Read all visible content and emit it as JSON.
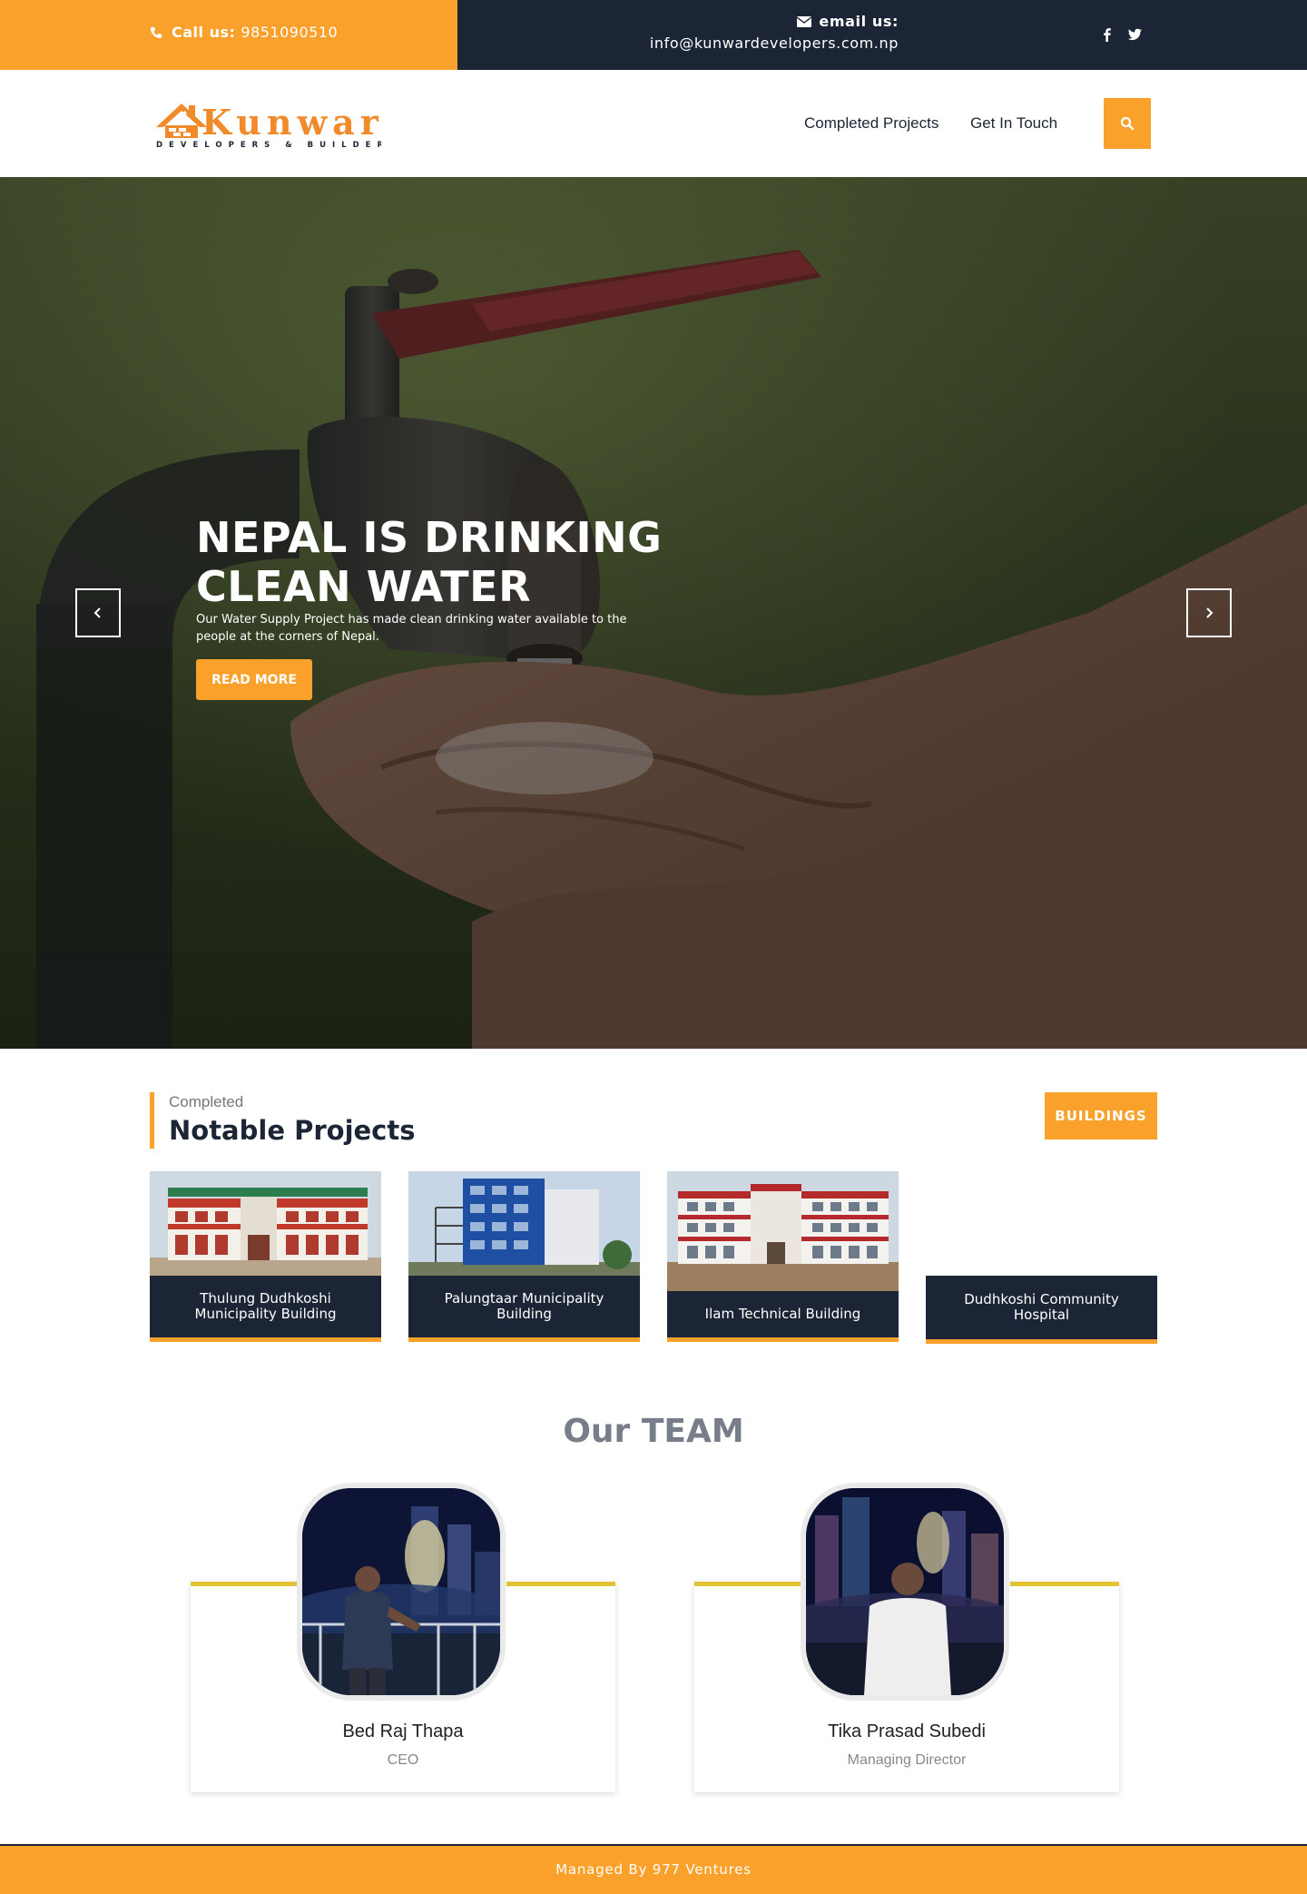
{
  "topbar": {
    "call_label": "Call us:",
    "phone": "9851090510",
    "email_label": "email us:",
    "email": "info@kunwardevelopers.com.np",
    "icons": [
      "phone-icon",
      "envelope-icon",
      "facebook-icon",
      "twitter-icon"
    ]
  },
  "header": {
    "logo_name": "Kunwar",
    "logo_tagline": "DEVELOPERS & BUILDERS",
    "nav": [
      "Completed Projects",
      "Get In Touch"
    ],
    "search_icon": "search-icon"
  },
  "hero": {
    "title": "NEPAL IS DRINKING CLEAN WATER",
    "text": "Our Water Supply Project has made clean drinking water available to the people at the corners of Nepal.",
    "cta": "READ MORE"
  },
  "projects": {
    "subtitle": "Completed",
    "title": "Notable Projects",
    "filter": "BUILDINGS",
    "items": [
      {
        "name": "Thulung Dudhkoshi Municipality Building"
      },
      {
        "name": "Palungtaar Municipality Building"
      },
      {
        "name": "Ilam Technical Building"
      },
      {
        "name": "Dudhkoshi Community Hospital"
      }
    ]
  },
  "team": {
    "title": "Our TEAM",
    "members": [
      {
        "name": "Bed Raj Thapa",
        "role": "CEO"
      },
      {
        "name": "Tika Prasad Subedi",
        "role": "Managing Director"
      }
    ]
  },
  "footer": {
    "text": "Managed By 977 Ventures"
  },
  "colors": {
    "accent": "#f9a12b",
    "navy": "#1c2535",
    "team_bar": "#e2c331"
  }
}
